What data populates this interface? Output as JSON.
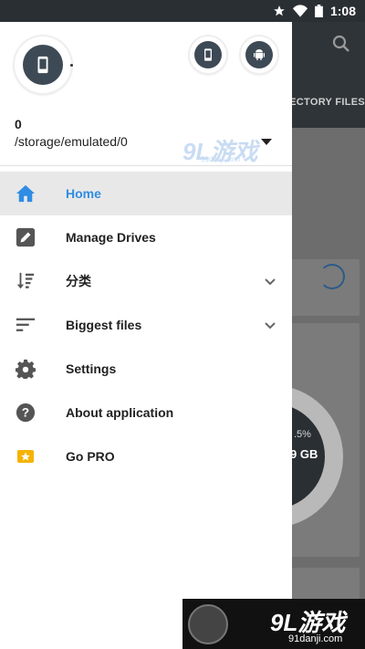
{
  "statusbar": {
    "time": "1:08"
  },
  "background": {
    "tab_label": "RECTORY FILES",
    "storage_percent": ".5%",
    "storage_size": "9 GB"
  },
  "drawer": {
    "header": {
      "count": "0",
      "path": "/storage/emulated/0",
      "watermark": "9L游戏",
      "watermark_url": "91danji.com"
    },
    "items": [
      {
        "label": "Home",
        "icon": "home-icon",
        "active": true
      },
      {
        "label": "Manage Drives",
        "icon": "edit-icon"
      },
      {
        "label": "分类",
        "icon": "sort-icon",
        "expandable": true
      },
      {
        "label": "Biggest files",
        "icon": "list-icon",
        "expandable": true
      },
      {
        "label": "Settings",
        "icon": "gear-icon"
      },
      {
        "label": "About application",
        "icon": "help-icon"
      },
      {
        "label": "Go PRO",
        "icon": "pro-badge-icon"
      }
    ]
  },
  "watermark_bottom": {
    "logo": "9L游戏",
    "url": "91danji.com"
  },
  "colors": {
    "accent": "#2f8de4",
    "header_dark": "#3d4a56",
    "pro": "#f5b300"
  }
}
